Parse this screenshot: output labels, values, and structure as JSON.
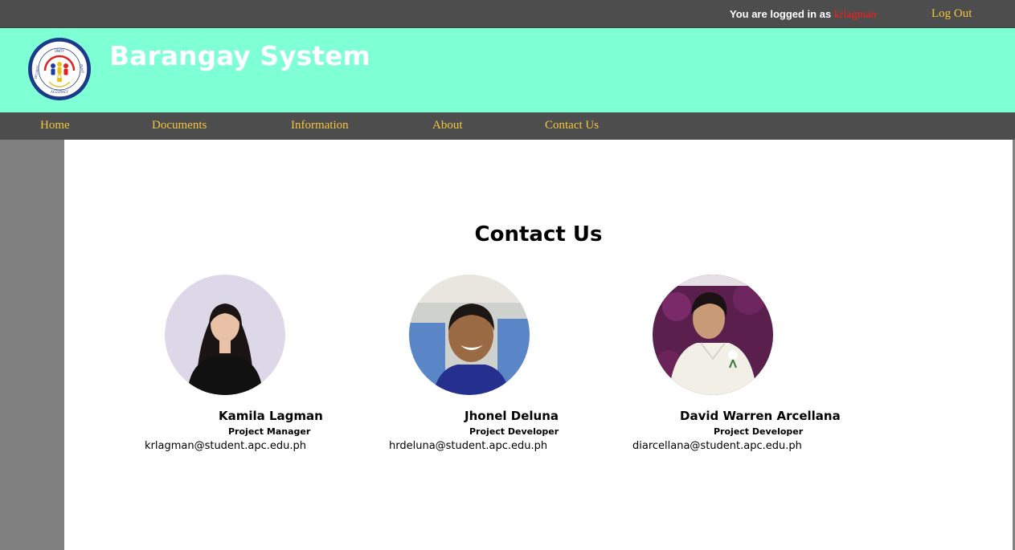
{
  "header": {
    "logged_in_prefix": "You are logged in as ",
    "username": "krlagman",
    "logout_label": "Log Out"
  },
  "banner": {
    "title": "Barangay System",
    "logo_icon": "barangay-seal-icon",
    "logo_text": [
      "UNITY",
      "SECURITY",
      "PEACE",
      "ACCURACY"
    ]
  },
  "nav": {
    "items": [
      {
        "label": "Home"
      },
      {
        "label": "Documents"
      },
      {
        "label": "Information"
      },
      {
        "label": "About"
      },
      {
        "label": "Contact Us"
      }
    ]
  },
  "main": {
    "title": "Contact Us",
    "members": [
      {
        "name": "Kamila Lagman",
        "role": "Project Manager",
        "email": "krlagman@student.apc.edu.ph"
      },
      {
        "name": "Jhonel Deluna",
        "role": "Project Developer",
        "email": "hrdeluna@student.apc.edu.ph"
      },
      {
        "name": "David Warren Arcellana",
        "role": "Project Developer",
        "email": "diarcellana@student.apc.edu.ph"
      }
    ]
  },
  "colors": {
    "topbar": "#4d4d4d",
    "banner": "#7fffd4",
    "nav_link": "#f5c542",
    "username": "#ff1a1a"
  }
}
